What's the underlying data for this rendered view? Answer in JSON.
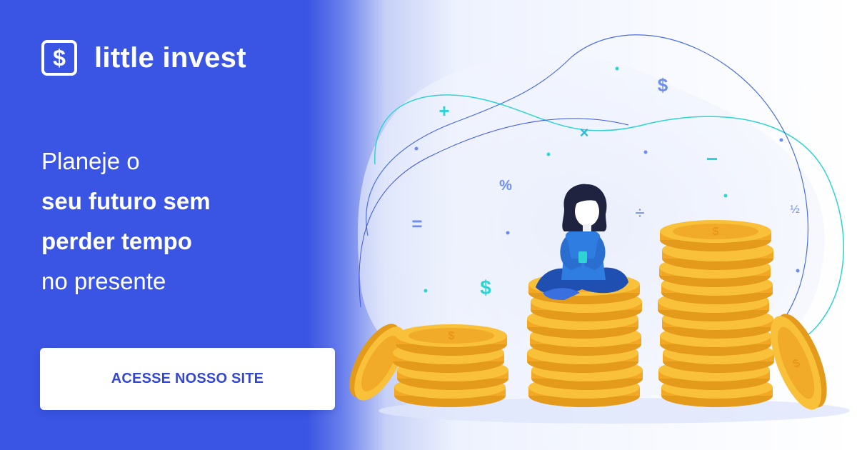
{
  "brand": {
    "name": "little invest",
    "icon_glyph": "$",
    "icon": "dollar-square-icon"
  },
  "headline": {
    "line1": "Planeje o",
    "line2": "seu futuro sem",
    "line3": "perder tempo",
    "line4": "no presente"
  },
  "cta": {
    "label": "ACESSE NOSSO SITE"
  },
  "illustration": {
    "symbols": {
      "plus": "+",
      "times": "×",
      "minus": "−",
      "percent": "%",
      "divide": "÷",
      "equals": "=",
      "half": "½",
      "dollar": "$"
    }
  },
  "colors": {
    "brand_blue": "#3a55e3",
    "cta_text": "#3448cf",
    "coin": "#f7b733",
    "coin_dark": "#e49a1a",
    "accent_cyan": "#2fd3d3",
    "person_shirt": "#2f7de1",
    "person_pants": "#1f4fb0"
  }
}
